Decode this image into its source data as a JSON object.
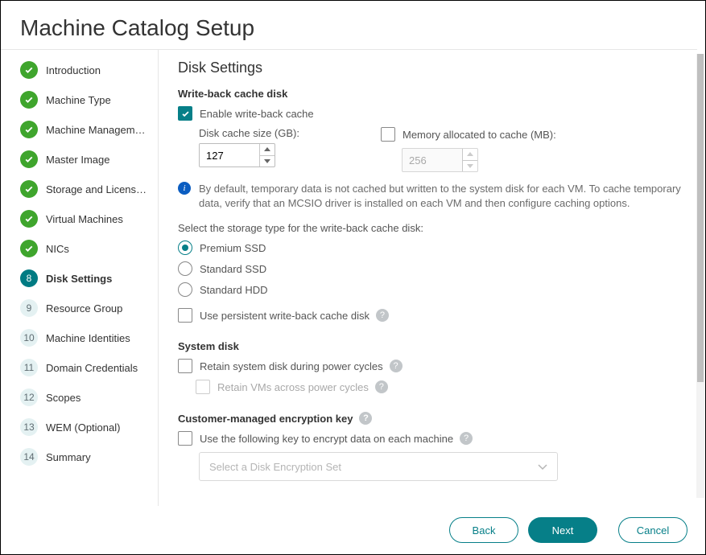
{
  "title": "Machine Catalog Setup",
  "page_heading": "Disk Settings",
  "sidebar": {
    "steps": [
      {
        "label": "Introduction",
        "state": "done"
      },
      {
        "label": "Machine Type",
        "state": "done"
      },
      {
        "label": "Machine Managem…",
        "state": "done"
      },
      {
        "label": "Master Image",
        "state": "done"
      },
      {
        "label": "Storage and Licens…",
        "state": "done"
      },
      {
        "label": "Virtual Machines",
        "state": "done"
      },
      {
        "label": "NICs",
        "state": "done"
      },
      {
        "label": "Disk Settings",
        "state": "current",
        "num": "8"
      },
      {
        "label": "Resource Group",
        "state": "pending",
        "num": "9"
      },
      {
        "label": "Machine Identities",
        "state": "pending",
        "num": "10"
      },
      {
        "label": "Domain Credentials",
        "state": "pending",
        "num": "11"
      },
      {
        "label": "Scopes",
        "state": "pending",
        "num": "12"
      },
      {
        "label": "WEM (Optional)",
        "state": "pending",
        "num": "13"
      },
      {
        "label": "Summary",
        "state": "pending",
        "num": "14"
      }
    ]
  },
  "wbc": {
    "heading": "Write-back cache disk",
    "enable_label": "Enable write-back cache",
    "enable_checked": true,
    "disk_size_label": "Disk cache size (GB):",
    "disk_size_value": "127",
    "mem_label": "Memory allocated to cache (MB):",
    "mem_checked": false,
    "mem_value": "256",
    "info": "By default, temporary data is not cached but written to the system disk for each VM. To cache temporary data, verify that an MCSIO driver is installed on each VM and then configure caching options.",
    "storage_type_label": "Select the storage type for the write-back cache disk:",
    "storage_types": [
      "Premium SSD",
      "Standard SSD",
      "Standard HDD"
    ],
    "storage_selected": "Premium SSD",
    "persistent_label": "Use persistent write-back cache disk"
  },
  "sysdisk": {
    "heading": "System disk",
    "retain_label": "Retain system disk during power cycles",
    "retain_vms_label": "Retain VMs across power cycles"
  },
  "cmek": {
    "heading": "Customer-managed encryption key",
    "use_key_label": "Use the following key to encrypt data on each machine",
    "select_placeholder": "Select a Disk Encryption Set"
  },
  "footer": {
    "back": "Back",
    "next": "Next",
    "cancel": "Cancel"
  }
}
